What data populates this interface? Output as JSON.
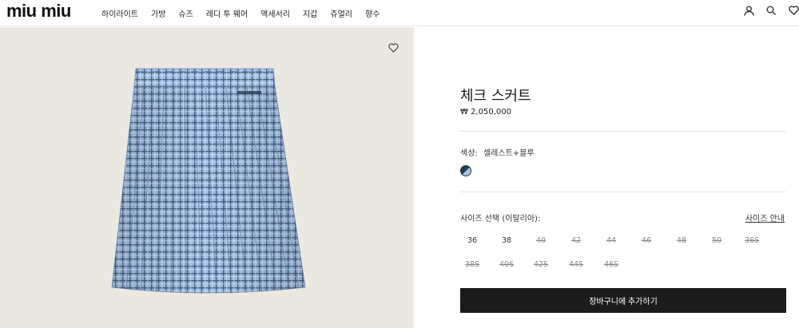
{
  "brand": {
    "logo": "miu miu"
  },
  "nav": [
    "하이라이트",
    "가방",
    "슈즈",
    "레디 투 웨어",
    "액세서리",
    "지갑",
    "쥬얼리",
    "향수"
  ],
  "header_icons": [
    "account-icon",
    "search-icon",
    "wishlist-icon"
  ],
  "product": {
    "title": "체크 스커트",
    "price": "₩ 2,050,000",
    "color_label": "색상:",
    "color_value": "셀레스트+블루",
    "swatch_colors": [
      "#1f3c5c",
      "#a7c4e3"
    ],
    "size_label": "사이즈 선택 (이탈리아):",
    "size_guide": "사이즈 안내",
    "sizes": [
      {
        "label": "36",
        "available": true
      },
      {
        "label": "38",
        "available": true
      },
      {
        "label": "40",
        "available": false
      },
      {
        "label": "42",
        "available": false
      },
      {
        "label": "44",
        "available": false
      },
      {
        "label": "46",
        "available": false
      },
      {
        "label": "48",
        "available": false
      },
      {
        "label": "50",
        "available": false
      },
      {
        "label": "36S",
        "available": false
      },
      {
        "label": "38S",
        "available": false
      },
      {
        "label": "40S",
        "available": false
      },
      {
        "label": "42S",
        "available": false
      },
      {
        "label": "44S",
        "available": false
      },
      {
        "label": "46S",
        "available": false
      }
    ],
    "add_to_cart": "장바구니에 추가하기"
  },
  "colors": {
    "image_background": "#ebe8e2",
    "skirt_blue": "#8fb2db",
    "button": "#1b1b1b"
  }
}
